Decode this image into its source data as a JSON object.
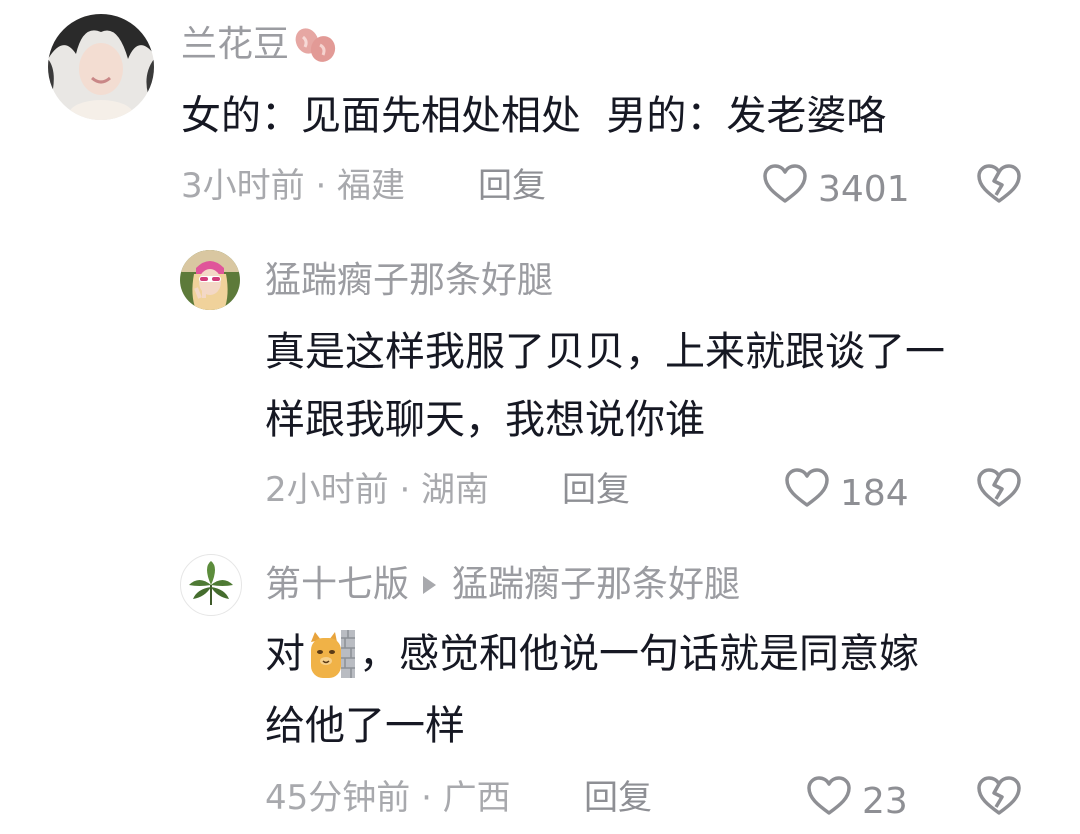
{
  "comments": [
    {
      "username": "兰花豆",
      "text": "女的：见面先相处相处  男的：发老婆咯",
      "time_location": "3小时前 · 福建",
      "reply_label": "回复",
      "likes": "3401",
      "icons": [
        "user-avatar",
        "beans-emoji-icon",
        "heart-icon",
        "broken-heart-icon"
      ]
    },
    {
      "username": "猛踹瘸子那条好腿",
      "text_line1": "真是这样我服了贝贝，上来就跟谈了一",
      "text_line2": "样跟我聊天，我想说你谁",
      "time_location": "2小时前 · 湖南",
      "reply_label": "回复",
      "likes": "184",
      "icons": [
        "user-avatar",
        "heart-icon",
        "broken-heart-icon"
      ]
    },
    {
      "username": "第十七版",
      "reply_to": "猛踹瘸子那条好腿",
      "text_prefix": "对",
      "text_rest": "，感觉和他说一句话就是同意嫁",
      "text_line2": "给他了一样",
      "time_location": "45分钟前 · 广西",
      "reply_label": "回复",
      "likes": "23",
      "icons": [
        "leaf-avatar",
        "cat-wall-emoji-icon",
        "heart-icon",
        "broken-heart-icon"
      ]
    }
  ],
  "colors": {
    "username": "#9b9ca1",
    "content": "#161823",
    "meta": "#a8a9ad",
    "icon_stroke": "#8e8f94"
  }
}
